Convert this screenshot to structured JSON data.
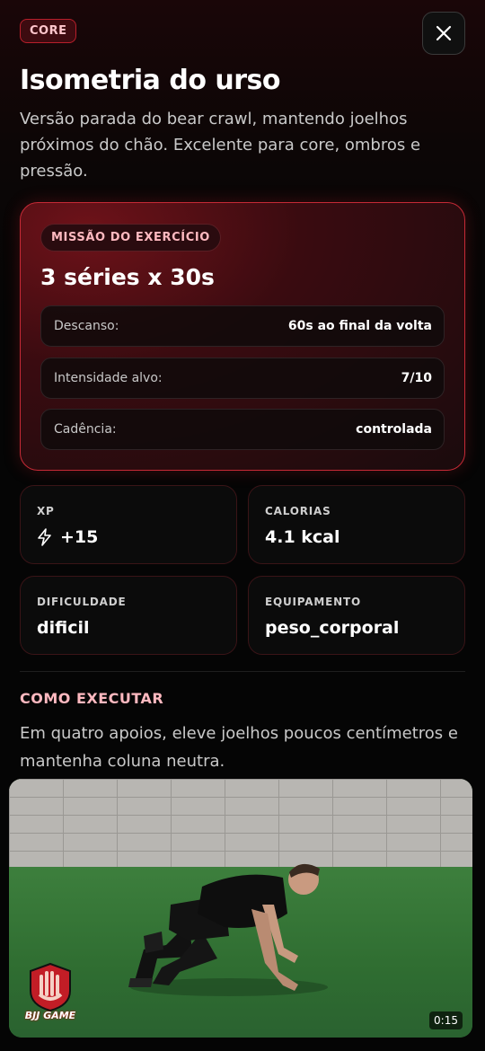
{
  "header": {
    "tag": "CORE",
    "title": "Isometria do urso",
    "subtitle": "Versão parada do bear crawl, mantendo joelhos próximos do chão. Excelente para core, ombros e pressão."
  },
  "mission": {
    "badge": "MISSÃO DO EXERCÍCIO",
    "headline": "3 séries x 30s",
    "rows": [
      {
        "label": "Descanso:",
        "value": "60s ao final da volta"
      },
      {
        "label": "Intensidade alvo:",
        "value": "7/10"
      },
      {
        "label": "Cadência:",
        "value": "controlada"
      }
    ]
  },
  "stats": [
    {
      "label": "XP",
      "value": "+15",
      "icon": "lightning-icon"
    },
    {
      "label": "CALORIAS",
      "value": "4.1 kcal"
    },
    {
      "label": "DIFICULDADE",
      "value": "dificil"
    },
    {
      "label": "EQUIPAMENTO",
      "value": "peso_corporal"
    }
  ],
  "how": {
    "title": "COMO EXECUTAR",
    "text": "Em quatro apoios, eleve joelhos poucos centímetros e mantenha coluna neutra."
  },
  "video": {
    "duration": "0:15",
    "logo_text": "BJJ GAME"
  },
  "colors": {
    "accent": "#c62a36",
    "tag_text": "#ffc6cc",
    "background": "#050505"
  }
}
